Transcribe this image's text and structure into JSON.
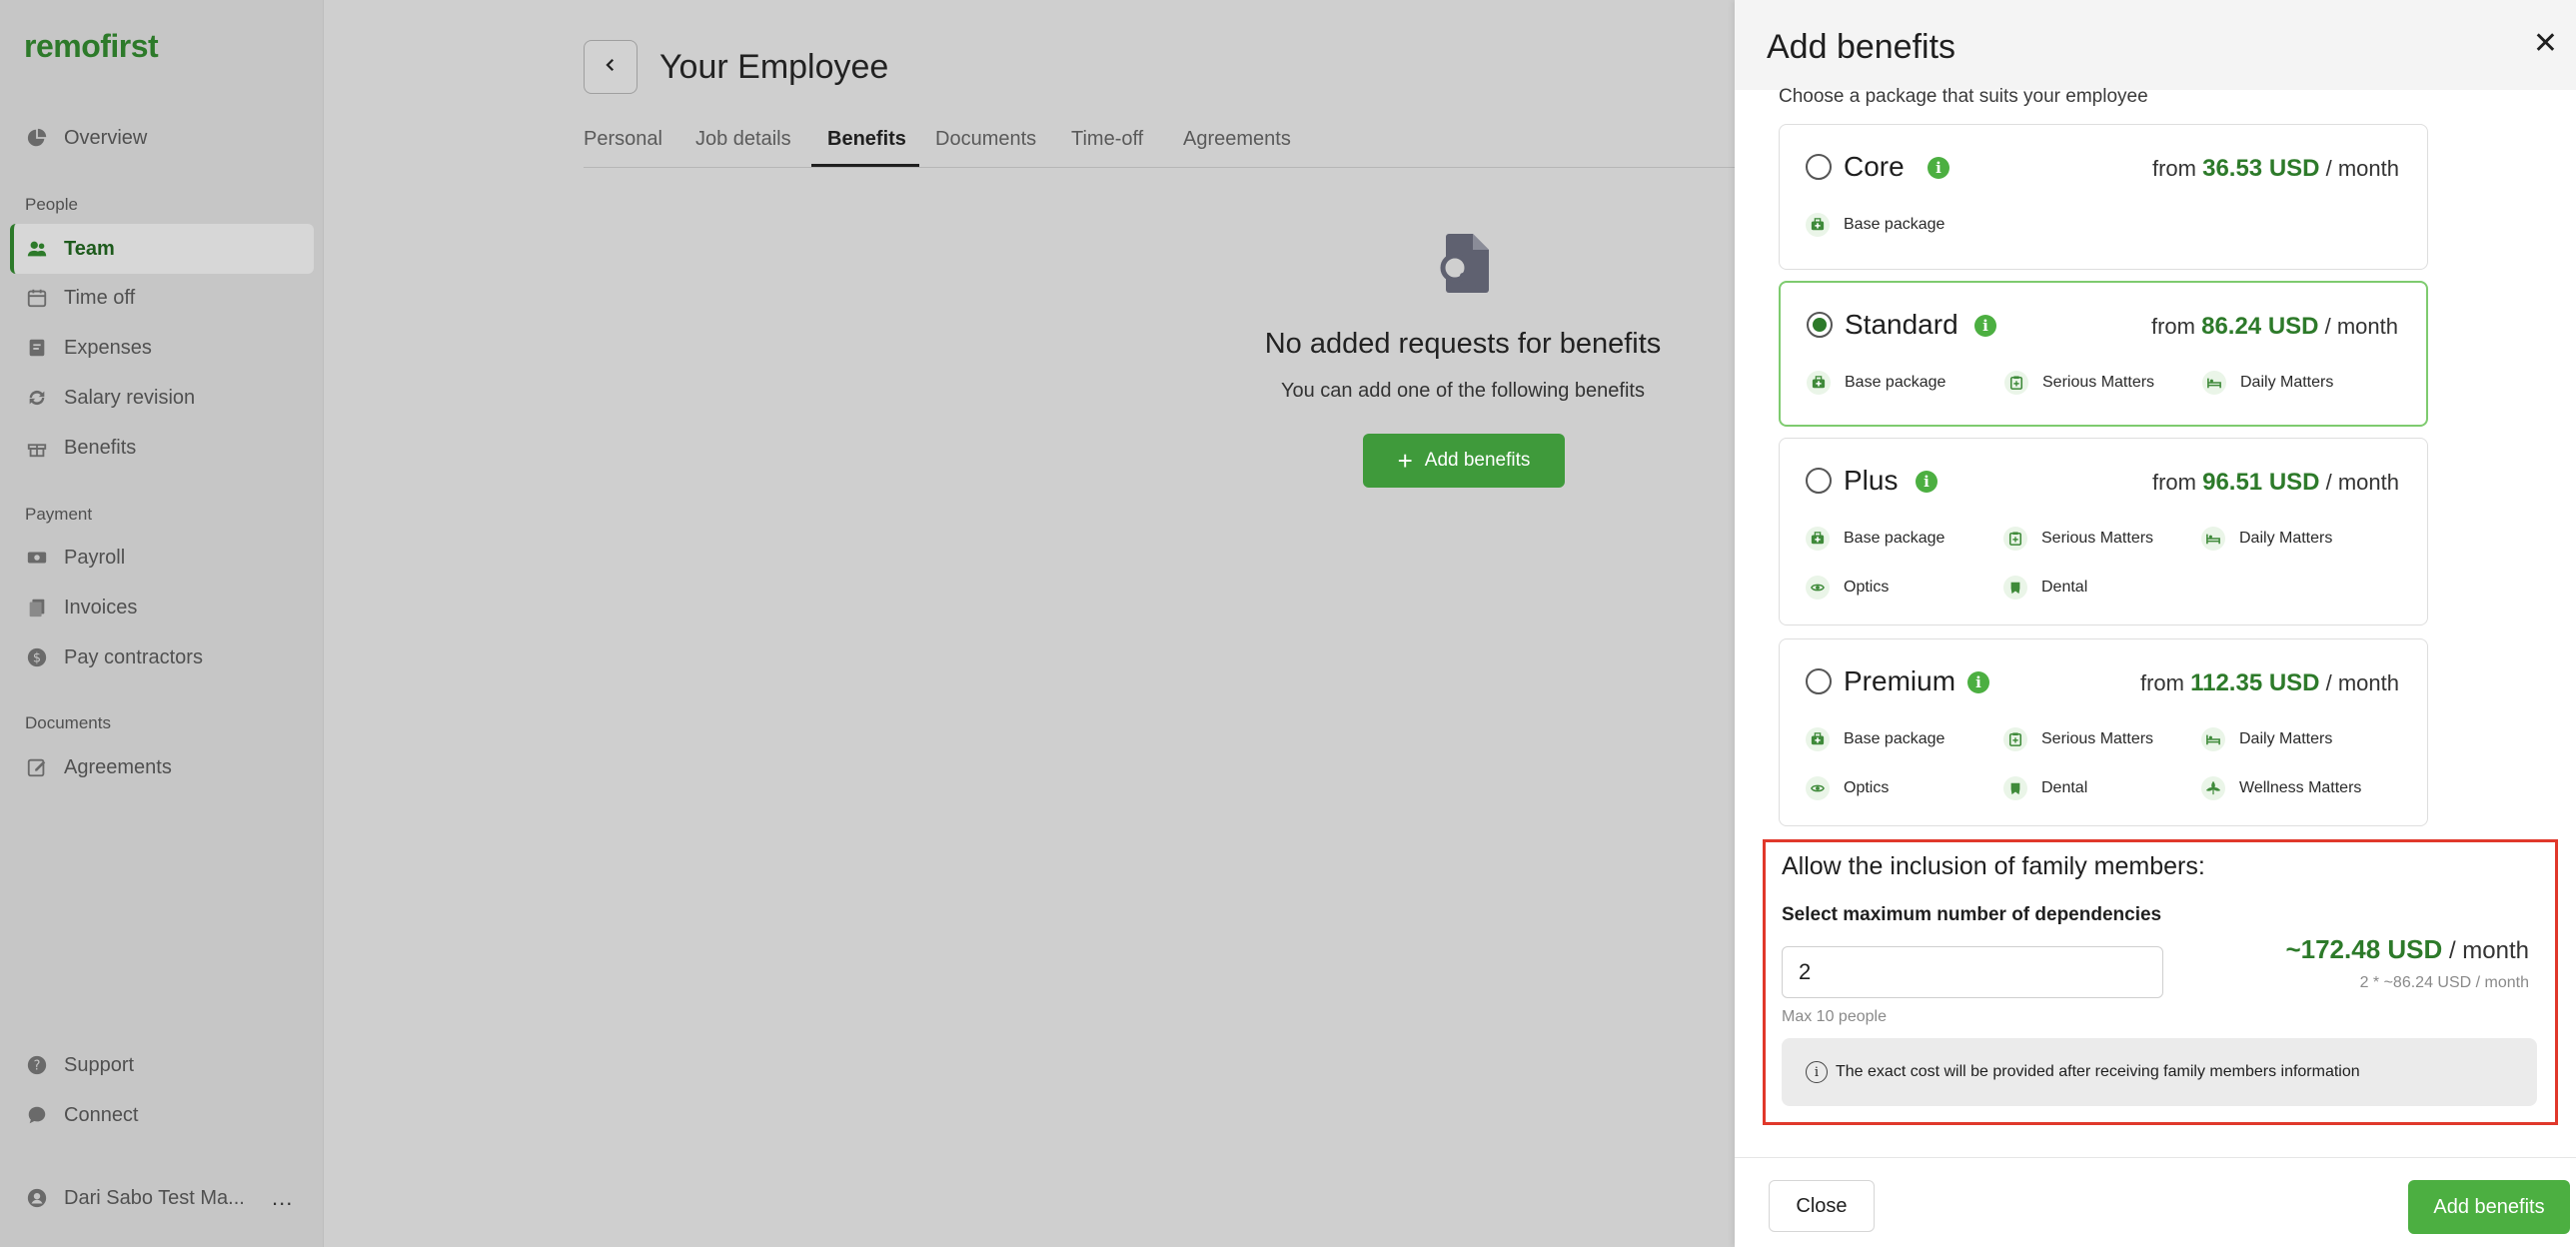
{
  "brand": {
    "logo": "remofirst",
    "accent": "#2d7a2a",
    "button_green": "#4caf41",
    "highlight_red": "#e0382b"
  },
  "sidebar": {
    "items": [
      {
        "label": "Overview",
        "icon": "pie-chart-icon"
      },
      {
        "label": "Team",
        "icon": "users-icon"
      },
      {
        "label": "Time off",
        "icon": "calendar-icon"
      },
      {
        "label": "Expenses",
        "icon": "receipt-icon"
      },
      {
        "label": "Salary revision",
        "icon": "refresh-icon"
      },
      {
        "label": "Benefits",
        "icon": "gift-icon"
      },
      {
        "label": "Payroll",
        "icon": "cash-icon"
      },
      {
        "label": "Invoices",
        "icon": "files-icon"
      },
      {
        "label": "Pay contractors",
        "icon": "dollar-icon"
      },
      {
        "label": "Agreements",
        "icon": "edit-icon"
      },
      {
        "label": "Support",
        "icon": "help-icon"
      },
      {
        "label": "Connect",
        "icon": "chat-icon"
      }
    ],
    "sections": {
      "people": "People",
      "payment": "Payment",
      "documents": "Documents"
    },
    "active": "Team",
    "user": {
      "name": "Dari Sabo Test Ma...",
      "more": "..."
    }
  },
  "main": {
    "title": "Your Employee",
    "tabs": [
      {
        "label": "Personal"
      },
      {
        "label": "Job details"
      },
      {
        "label": "Benefits"
      },
      {
        "label": "Documents"
      },
      {
        "label": "Time-off"
      },
      {
        "label": "Agreements"
      }
    ],
    "active_tab": "Benefits",
    "empty": {
      "title": "No added requests for benefits",
      "subtitle": "You can add one of the following benefits",
      "button": "Add benefits"
    }
  },
  "drawer": {
    "title": "Add benefits",
    "subtitle": "Choose a package that suits your employee",
    "packages": [
      {
        "name": "Core",
        "price_prefix": "from",
        "price": "36.53 USD",
        "price_suffix": "/ month",
        "selected": false,
        "features": [
          {
            "label": "Base package",
            "icon": "medkit-icon"
          }
        ]
      },
      {
        "name": "Standard",
        "price_prefix": "from",
        "price": "86.24 USD",
        "price_suffix": "/ month",
        "selected": true,
        "features": [
          {
            "label": "Base package",
            "icon": "medkit-icon"
          },
          {
            "label": "Serious Matters",
            "icon": "clipboard-icon"
          },
          {
            "label": "Daily Matters",
            "icon": "bed-icon"
          }
        ]
      },
      {
        "name": "Plus",
        "price_prefix": "from",
        "price": "96.51 USD",
        "price_suffix": "/ month",
        "selected": false,
        "features": [
          {
            "label": "Base package",
            "icon": "medkit-icon"
          },
          {
            "label": "Serious Matters",
            "icon": "clipboard-icon"
          },
          {
            "label": "Daily Matters",
            "icon": "bed-icon"
          },
          {
            "label": "Optics",
            "icon": "eye-icon"
          },
          {
            "label": "Dental",
            "icon": "tooth-icon"
          }
        ]
      },
      {
        "name": "Premium",
        "price_prefix": "from",
        "price": "112.35 USD",
        "price_suffix": "/ month",
        "selected": false,
        "features": [
          {
            "label": "Base package",
            "icon": "medkit-icon"
          },
          {
            "label": "Serious Matters",
            "icon": "clipboard-icon"
          },
          {
            "label": "Daily Matters",
            "icon": "bed-icon"
          },
          {
            "label": "Optics",
            "icon": "eye-icon"
          },
          {
            "label": "Dental",
            "icon": "tooth-icon"
          },
          {
            "label": "Wellness Matters",
            "icon": "wellness-icon"
          }
        ]
      }
    ],
    "family": {
      "title": "Allow the inclusion of family members:",
      "label": "Select maximum number of dependencies",
      "value": "2",
      "hint": "Max 10 people",
      "total": "~172.48 USD",
      "total_suffix": "/ month",
      "formula": "2 * ~86.24 USD / month",
      "notice": "The exact cost will be provided after receiving family members information"
    },
    "footer": {
      "close": "Close",
      "add": "Add benefits"
    }
  }
}
